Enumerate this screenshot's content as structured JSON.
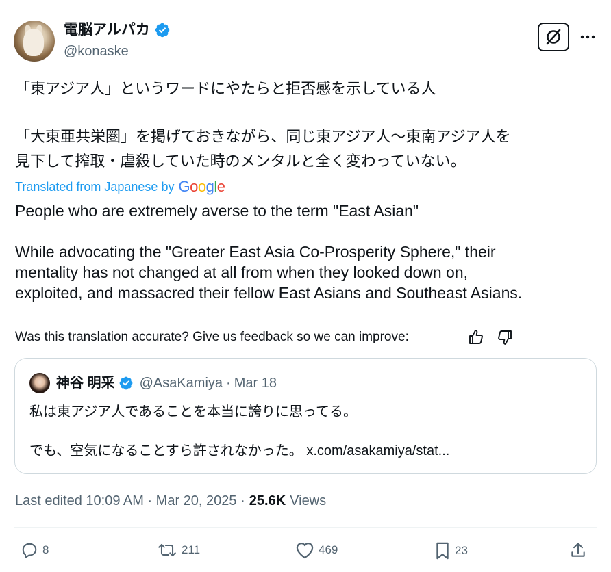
{
  "author": {
    "display_name": "電脳アルパカ",
    "handle": "@konaske"
  },
  "tweet": {
    "jp_line1": "「東アジア人」というワードにやたらと拒否感を示している人",
    "jp_line2": "「大東亜共栄圏」を掲げておきながら、同じ東アジア人〜東南アジア人を",
    "jp_line3": "見下して搾取・虐殺していた時のメンタルと全く変わっていない。",
    "translated_label": "Translated from Japanese by",
    "translated_brand": [
      "G",
      "o",
      "o",
      "g",
      "l",
      "e"
    ],
    "en_line1": "People who are extremely averse to the term \"East Asian\"",
    "en_line2": "While advocating the \"Greater East Asia Co-Prosperity Sphere,\" their",
    "en_line3": "mentality has not changed at all from when they looked down on,",
    "en_line4": "exploited, and massacred their fellow East Asians and Southeast Asians."
  },
  "feedback": {
    "text": "Was this translation accurate? Give us feedback so we can improve:"
  },
  "quoted": {
    "display_name": "神谷 明采",
    "handle": "@AsaKamiya",
    "separator": "·",
    "date": "Mar 18",
    "line1": "私は東アジア人であることを本当に誇りに思ってる。",
    "line2": "でも、空気になることすら許されなかった。 x.com/asakamiya/stat..."
  },
  "meta": {
    "edited": "Last edited 10:09 AM · Mar 20, 2025 ·",
    "views_count": "25.6K",
    "views_label": "Views"
  },
  "actions": {
    "replies": "8",
    "reposts": "211",
    "likes": "469",
    "bookmarks": "23"
  },
  "colors": {
    "accent": "#1d9bf0",
    "text": "#0f1419",
    "secondary": "#536471",
    "border": "#cfd9de",
    "google_blue": "#4285f4",
    "google_red": "#ea4335",
    "google_yellow": "#fbbc05",
    "google_green": "#34a853"
  }
}
